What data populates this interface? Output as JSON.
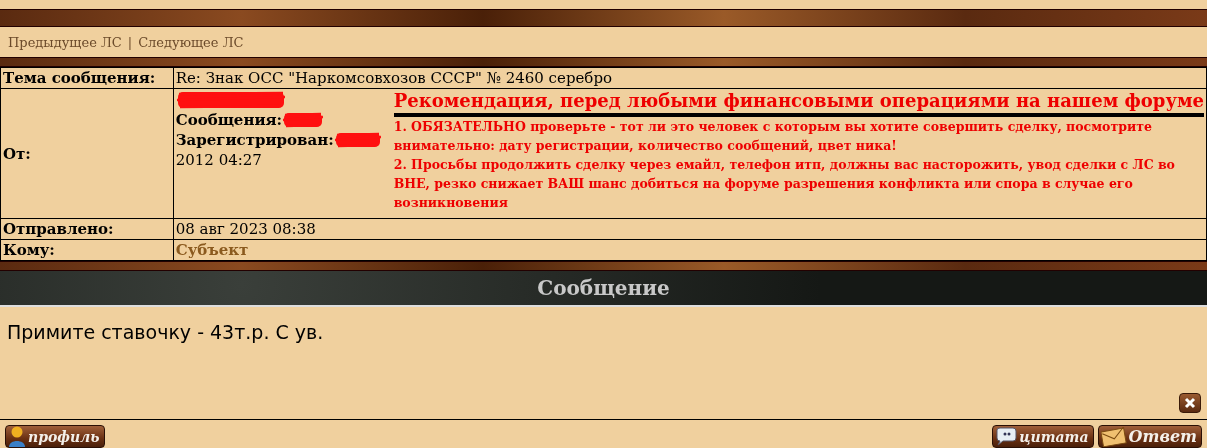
{
  "nav": {
    "links": [
      "Предыдущее ЛС",
      "Следующее ЛС"
    ],
    "separator": "|"
  },
  "header": {
    "subject_label": "Тема сообщения:",
    "subject": "Re: Знак ОСС \"Наркомсовхозов СССР\" № 2460 серебро",
    "from_label": "От:",
    "posts_label": "Сообщения:",
    "registered_label": "Зарегистрирован:",
    "registered_tail": "2012 04:27",
    "sent_label": "Отправлено:",
    "sent": "08 авг 2023 08:38",
    "to_label": "Кому:",
    "to": "Субъект"
  },
  "warning": {
    "title": "Рекомендация, перед любыми финансовыми операциями на нашем форуме",
    "paragraphs": [
      "1. ОБЯЗАТЕЛЬНО проверьте - тот ли это человек с которым вы хотите совершить сделку, посмотрите внимательно: дату регистрации, количество сообщений, цвет ника!",
      "2. Просьбы продолжить сделку через емайл, телефон итп, должны вас насторожить, увод сделки с ЛС во ВНЕ, резко снижает ВАШ шанс добиться на форуме разрешения конфликта или спора в случае его возникновения"
    ]
  },
  "message": {
    "heading": "Сообщение",
    "body": "Примите ставочку - 43т.р. С ув."
  },
  "buttons": [
    {
      "kind": "profile",
      "label": "профиль"
    },
    {
      "kind": "quote",
      "label": "цитата"
    },
    {
      "kind": "reply",
      "label": "Ответ"
    }
  ]
}
